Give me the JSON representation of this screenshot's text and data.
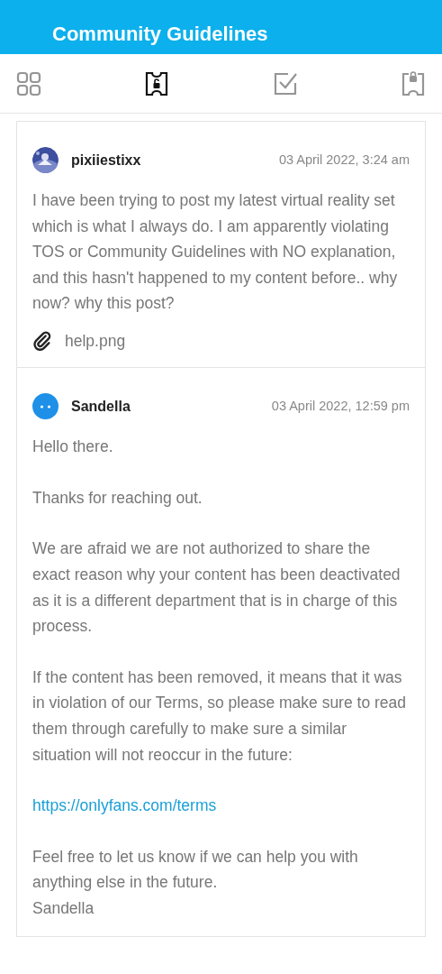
{
  "header": {
    "title": "Community Guidelines"
  },
  "tabs": [
    {
      "kind": "grid",
      "selected": false
    },
    {
      "kind": "ticket",
      "selected": true
    },
    {
      "kind": "check",
      "selected": false
    },
    {
      "kind": "lock-ticket",
      "selected": false
    }
  ],
  "messages": [
    {
      "avatar": {
        "kind": "picture"
      },
      "author": "pixiiestixx",
      "time": "03 April 2022, 3:24 am",
      "paragraphs": [
        {
          "kind": "text",
          "text": "I have been trying to post my latest virtual reality set which is what I always do. I am apparently violating TOS or Community Guidelines with NO explanation, and this hasn't happened to my content before.. why now? why this post?"
        }
      ],
      "attachment": "help.png"
    },
    {
      "avatar": {
        "kind": "default"
      },
      "author": "Sandella",
      "time": "03 April 2022, 12:59 pm",
      "paragraphs": [
        {
          "kind": "text",
          "text": "Hello there."
        },
        {
          "kind": "text",
          "text": "Thanks for reaching out."
        },
        {
          "kind": "text",
          "text": "We are afraid we are not authorized to share the exact reason why your content has been deactivated as it is a different department that is in charge of this process."
        },
        {
          "kind": "text",
          "text": "If the content has been removed, it means that it was in violation of our Terms, so please make sure to read them through carefully to make sure a similar situation will not reoccur in the future:"
        },
        {
          "kind": "link",
          "text": "https://onlyfans.com/terms"
        },
        {
          "kind": "text",
          "text": "Feel free to let us know if we can help you with anything else in the future."
        },
        {
          "kind": "signature",
          "text": "Sandella"
        }
      ]
    }
  ]
}
